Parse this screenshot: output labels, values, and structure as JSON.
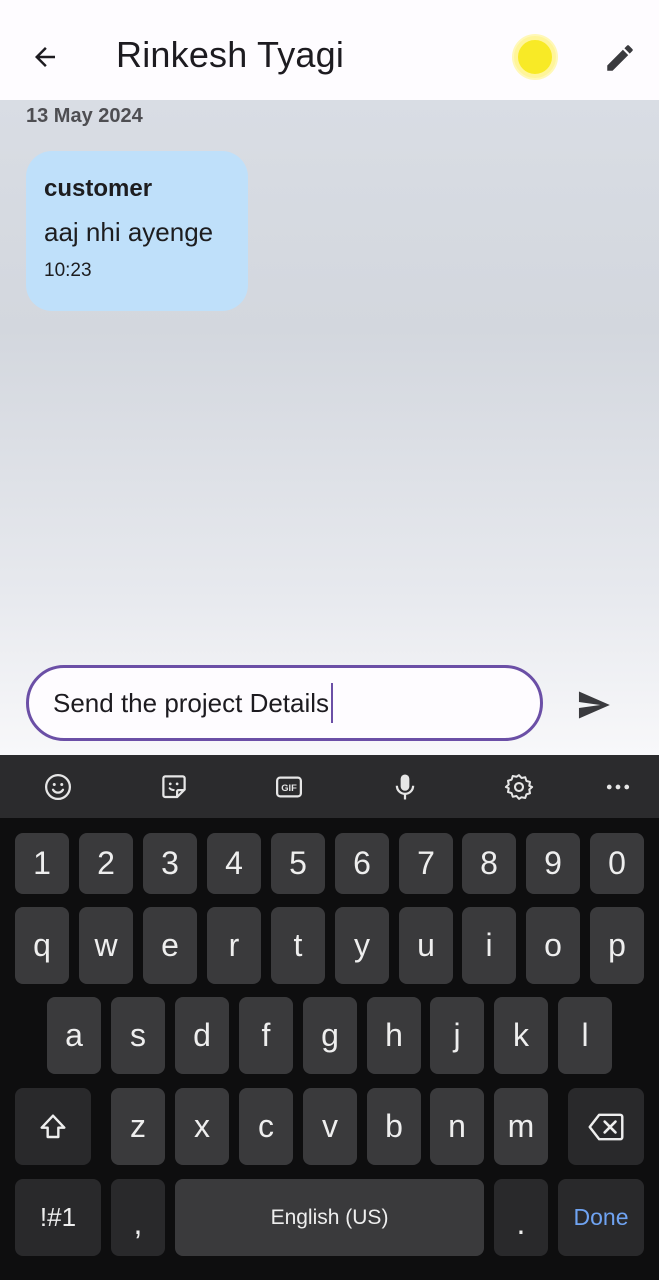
{
  "header": {
    "back_icon": "arrow-left-icon",
    "contact_name": "Rinkesh Tyagi",
    "status_color": "#f8ea26",
    "edit_icon": "pencil-icon"
  },
  "chat": {
    "date_label": "13 May 2024",
    "messages": [
      {
        "sender": "customer",
        "text": "aaj nhi ayenge",
        "time": "10:23",
        "bubble_color": "#bfe0fa"
      }
    ]
  },
  "composer": {
    "value": "Send the project Details",
    "send_icon": "send-icon",
    "accent": "#6b4fa6"
  },
  "keyboard": {
    "toolbar": [
      "emoji-icon",
      "sticker-icon",
      "gif-icon",
      "microphone-icon",
      "settings-icon",
      "more-icon"
    ],
    "row_numbers": [
      "1",
      "2",
      "3",
      "4",
      "5",
      "6",
      "7",
      "8",
      "9",
      "0"
    ],
    "row_top": [
      "q",
      "w",
      "e",
      "r",
      "t",
      "y",
      "u",
      "i",
      "o",
      "p"
    ],
    "row_middle": [
      "a",
      "s",
      "d",
      "f",
      "g",
      "h",
      "j",
      "k",
      "l"
    ],
    "row_bottom": [
      "z",
      "x",
      "c",
      "v",
      "b",
      "n",
      "m"
    ],
    "symbols_label": "!#1",
    "comma_label": ",",
    "space_label": "English (US)",
    "period_label": ".",
    "done_label": "Done",
    "done_color": "#6fa3f2"
  }
}
